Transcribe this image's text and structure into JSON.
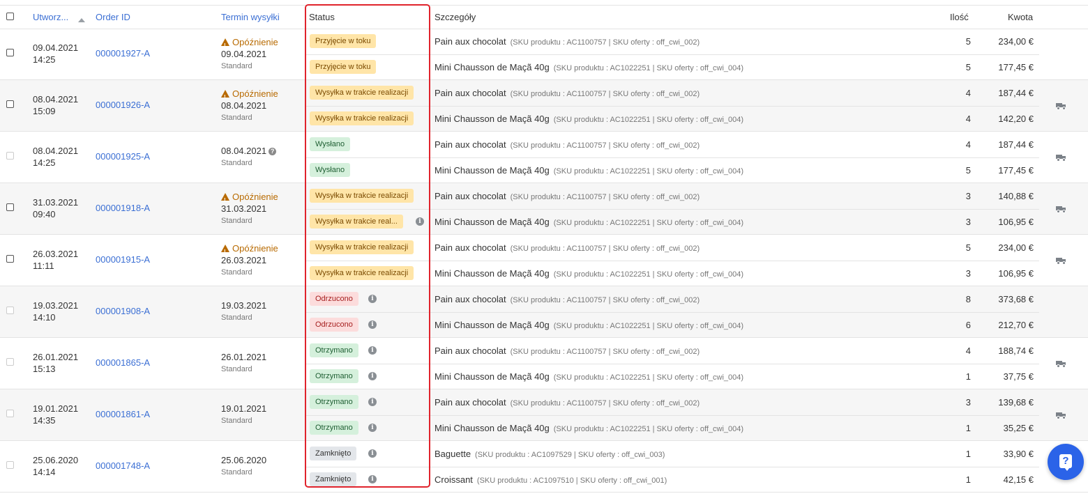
{
  "header": {
    "created": "Utworz...",
    "order_id": "Order ID",
    "ship_deadline": "Termin wysyłki",
    "status": "Status",
    "details": "Szczegóły",
    "qty": "Ilość",
    "amount": "Kwota"
  },
  "delay_label": "Opóźnienie",
  "orders": [
    {
      "date": "09.04.2021",
      "time": "14:25",
      "id": "000001927-A",
      "deadline": "09.04.2021",
      "shipping": "Standard",
      "delayed": true,
      "checkbox": "enabled",
      "truck": false,
      "items": [
        {
          "status": "Przyjęcie w toku",
          "status_color": "yellow",
          "info": false,
          "product": "Pain aux chocolat",
          "sku": "(SKU produktu : AC1100757 | SKU oferty : off_cwi_002)",
          "qty": "5",
          "amount": "234,00 €"
        },
        {
          "status": "Przyjęcie w toku",
          "status_color": "yellow",
          "info": false,
          "product": "Mini Chausson de Maçã 40g",
          "sku": "(SKU produktu : AC1022251 | SKU oferty : off_cwi_004)",
          "qty": "5",
          "amount": "177,45 €"
        }
      ]
    },
    {
      "date": "08.04.2021",
      "time": "15:09",
      "id": "000001926-A",
      "deadline": "08.04.2021",
      "shipping": "Standard",
      "delayed": true,
      "checkbox": "enabled",
      "truck": true,
      "items": [
        {
          "status": "Wysyłka w trakcie realizacji",
          "status_color": "yellow",
          "info": false,
          "product": "Pain aux chocolat",
          "sku": "(SKU produktu : AC1100757 | SKU oferty : off_cwi_002)",
          "qty": "4",
          "amount": "187,44 €"
        },
        {
          "status": "Wysyłka w trakcie realizacji",
          "status_color": "yellow",
          "info": false,
          "product": "Mini Chausson de Maçã 40g",
          "sku": "(SKU produktu : AC1022251 | SKU oferty : off_cwi_004)",
          "qty": "4",
          "amount": "142,20 €"
        }
      ]
    },
    {
      "date": "08.04.2021",
      "time": "14:25",
      "id": "000001925-A",
      "deadline": "08.04.2021",
      "shipping": "Standard",
      "delayed": false,
      "deadline_help": true,
      "checkbox": "disabled",
      "truck": true,
      "items": [
        {
          "status": "Wysłano",
          "status_color": "green",
          "info": false,
          "product": "Pain aux chocolat",
          "sku": "(SKU produktu : AC1100757 | SKU oferty : off_cwi_002)",
          "qty": "4",
          "amount": "187,44 €"
        },
        {
          "status": "Wysłano",
          "status_color": "green",
          "info": false,
          "product": "Mini Chausson de Maçã 40g",
          "sku": "(SKU produktu : AC1022251 | SKU oferty : off_cwi_004)",
          "qty": "5",
          "amount": "177,45 €"
        }
      ]
    },
    {
      "date": "31.03.2021",
      "time": "09:40",
      "id": "000001918-A",
      "deadline": "31.03.2021",
      "shipping": "Standard",
      "delayed": true,
      "checkbox": "enabled",
      "truck": true,
      "items": [
        {
          "status": "Wysyłka w trakcie realizacji",
          "status_color": "yellow",
          "info": false,
          "product": "Pain aux chocolat",
          "sku": "(SKU produktu : AC1100757 | SKU oferty : off_cwi_002)",
          "qty": "3",
          "amount": "140,88 €"
        },
        {
          "status": "Wysyłka w trakcie real...",
          "status_color": "yellow",
          "info": true,
          "product": "Mini Chausson de Maçã 40g",
          "sku": "(SKU produktu : AC1022251 | SKU oferty : off_cwi_004)",
          "qty": "3",
          "amount": "106,95 €"
        }
      ]
    },
    {
      "date": "26.03.2021",
      "time": "11:11",
      "id": "000001915-A",
      "deadline": "26.03.2021",
      "shipping": "Standard",
      "delayed": true,
      "checkbox": "enabled",
      "truck": true,
      "items": [
        {
          "status": "Wysyłka w trakcie realizacji",
          "status_color": "yellow",
          "info": false,
          "product": "Pain aux chocolat",
          "sku": "(SKU produktu : AC1100757 | SKU oferty : off_cwi_002)",
          "qty": "5",
          "amount": "234,00 €"
        },
        {
          "status": "Wysyłka w trakcie realizacji",
          "status_color": "yellow",
          "info": false,
          "product": "Mini Chausson de Maçã 40g",
          "sku": "(SKU produktu : AC1022251 | SKU oferty : off_cwi_004)",
          "qty": "3",
          "amount": "106,95 €"
        }
      ]
    },
    {
      "date": "19.03.2021",
      "time": "14:10",
      "id": "000001908-A",
      "deadline": "19.03.2021",
      "shipping": "Standard",
      "delayed": false,
      "checkbox": "disabled",
      "truck": false,
      "items": [
        {
          "status": "Odrzucono",
          "status_color": "red",
          "info": true,
          "product": "Pain aux chocolat",
          "sku": "(SKU produktu : AC1100757 | SKU oferty : off_cwi_002)",
          "qty": "8",
          "amount": "373,68 €"
        },
        {
          "status": "Odrzucono",
          "status_color": "red",
          "info": true,
          "product": "Mini Chausson de Maçã 40g",
          "sku": "(SKU produktu : AC1022251 | SKU oferty : off_cwi_004)",
          "qty": "6",
          "amount": "212,70 €"
        }
      ]
    },
    {
      "date": "26.01.2021",
      "time": "15:13",
      "id": "000001865-A",
      "deadline": "26.01.2021",
      "shipping": "Standard",
      "delayed": false,
      "checkbox": "disabled",
      "truck": true,
      "items": [
        {
          "status": "Otrzymano",
          "status_color": "green",
          "info": true,
          "product": "Pain aux chocolat",
          "sku": "(SKU produktu : AC1100757 | SKU oferty : off_cwi_002)",
          "qty": "4",
          "amount": "188,74 €"
        },
        {
          "status": "Otrzymano",
          "status_color": "green",
          "info": true,
          "product": "Mini Chausson de Maçã 40g",
          "sku": "(SKU produktu : AC1022251 | SKU oferty : off_cwi_004)",
          "qty": "1",
          "amount": "37,75 €"
        }
      ]
    },
    {
      "date": "19.01.2021",
      "time": "14:35",
      "id": "000001861-A",
      "deadline": "19.01.2021",
      "shipping": "Standard",
      "delayed": false,
      "checkbox": "disabled",
      "truck": true,
      "items": [
        {
          "status": "Otrzymano",
          "status_color": "green",
          "info": true,
          "product": "Pain aux chocolat",
          "sku": "(SKU produktu : AC1100757 | SKU oferty : off_cwi_002)",
          "qty": "3",
          "amount": "139,68 €"
        },
        {
          "status": "Otrzymano",
          "status_color": "green",
          "info": true,
          "product": "Mini Chausson de Maçã 40g",
          "sku": "(SKU produktu : AC1022251 | SKU oferty : off_cwi_004)",
          "qty": "1",
          "amount": "35,25 €"
        }
      ]
    },
    {
      "date": "25.06.2020",
      "time": "14:14",
      "id": "000001748-A",
      "deadline": "25.06.2020",
      "shipping": "Standard",
      "delayed": false,
      "checkbox": "disabled",
      "truck": true,
      "items": [
        {
          "status": "Zamknięto",
          "status_color": "gray",
          "info": true,
          "product": "Baguette",
          "sku": "(SKU produktu : AC1097529 | SKU oferty : off_cwi_003)",
          "qty": "1",
          "amount": "33,90 €"
        },
        {
          "status": "Zamknięto",
          "status_color": "gray",
          "info": true,
          "product": "Croissant",
          "sku": "(SKU produktu : AC1097510 | SKU oferty : off_cwi_001)",
          "qty": "1",
          "amount": "42,15 €"
        }
      ]
    }
  ],
  "colors": {
    "link": "#3b6fd4",
    "highlight": "#e0232c",
    "help_button": "#2b63e8"
  },
  "icons": {
    "sort": "sort-asc-icon",
    "warning": "warning-icon",
    "info": "info-icon",
    "truck": "truck-icon",
    "help": "help-icon"
  }
}
